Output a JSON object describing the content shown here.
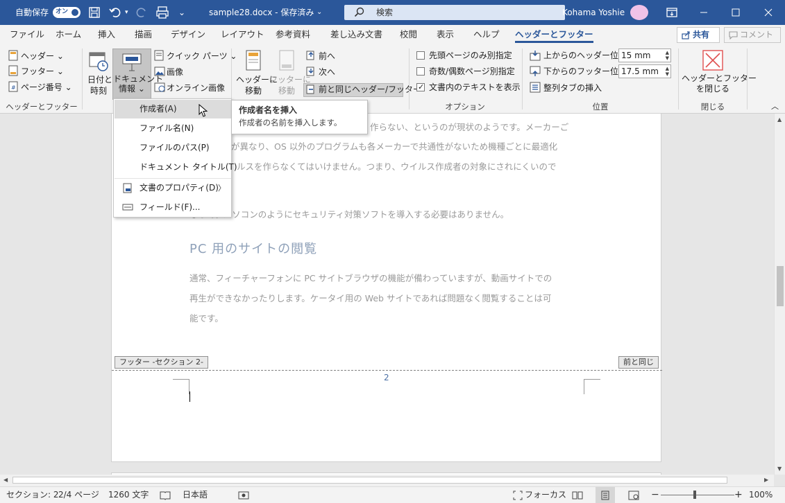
{
  "colors": {
    "title_bar": "#2b579a",
    "accent": "#2b579a",
    "ribbon_bg": "#f3f3f3",
    "close_red": "#e05050"
  },
  "titlebar": {
    "autosave_label": "自動保存",
    "autosave_state": "オン",
    "document_title": "sample28.docx - 保存済み",
    "title_chevron": "⌄",
    "search_placeholder": "検索",
    "user_name": "Kohama Yoshie",
    "qat_more": "⌄"
  },
  "tabs": {
    "items": [
      "ファイル",
      "ホーム",
      "挿入",
      "描画",
      "デザイン",
      "レイアウト",
      "参考資料",
      "差し込み文書",
      "校閲",
      "表示",
      "ヘルプ",
      "ヘッダーとフッター"
    ],
    "active": "ヘッダーとフッター",
    "share": "共有",
    "comment": "コメント"
  },
  "ribbon": {
    "hf_group": {
      "header": "ヘッダー",
      "footer": "フッター",
      "page_number": "ページ番号",
      "label": "ヘッダーとフッター"
    },
    "insert_group": {
      "date_time_line1": "日付と",
      "date_time_line2": "時刻",
      "docinfo_line1": "ドキュメント",
      "docinfo_line2": "情報",
      "quick_parts": "クイック パーツ",
      "image": "画像",
      "online_image": "オンライン画像"
    },
    "nav_group": {
      "goto_header_line1": "ヘッダーに",
      "goto_header_line2": "移動",
      "goto_footer_line1": "フッターに",
      "goto_footer_line2": "移動",
      "prev": "前へ",
      "next": "次へ",
      "link_previous": "前と同じヘッダー/フッター"
    },
    "options_group": {
      "first_page": "先頭ページのみ別指定",
      "odd_even": "奇数/偶数ページ別指定",
      "show_text": "文書内のテキストを表示",
      "show_text_checked": true,
      "label": "オプション"
    },
    "position_group": {
      "header_pos_label": "上からのヘッダー位置:",
      "header_pos_value": "15 mm",
      "footer_pos_label": "下からのフッター位置:",
      "footer_pos_value": "17.5 mm",
      "align_tab": "整列タブの挿入",
      "label": "位置"
    },
    "close_group": {
      "close_line1": "ヘッダーとフッター",
      "close_line2": "を閉じる",
      "label": "閉じる"
    }
  },
  "dropdown": {
    "items": [
      {
        "label": "作成者(A)"
      },
      {
        "label": "ファイル名(N)"
      },
      {
        "label": "ファイルのパス(P)"
      },
      {
        "label": "ドキュメント タイトル(T)"
      },
      {
        "label": "文書のプロパティ(D)"
      },
      {
        "label": "フィールド(F)..."
      }
    ]
  },
  "tooltip": {
    "title": "作成者名を挿入",
    "description": "作成者の名前を挿入します。"
  },
  "document": {
    "line1": "作らない、というのが現状のようです。メーカーご",
    "line2": "が異なり、OS 以外のプログラムも各メーカーで共通性がないため機種ごとに最適化",
    "line3": "ルスを作らなくてはいけません。つまり、ウイルス作成者の対象にされにくいので",
    "line4": "なって、パソコンのようにセキュリティ対策ソフトを導入する必要はありません。",
    "heading": "PC 用のサイトの閲覧",
    "para2_line1": "通常、フィーチャーフォンに PC サイトブラウザの機能が備わっていますが、動画サイトでの",
    "para2_line2": "再生ができなかったりします。ケータイ用の Web サイトであれば問題なく閲覧することは可",
    "para2_line3": "能です。",
    "footer_label": "フッター -セクション 2-",
    "same_as_previous": "前と同じ",
    "page_number": "2"
  },
  "statusbar": {
    "section": "セクション: 2",
    "page": "2/4 ページ",
    "words": "1260 文字",
    "language": "日本語",
    "focus": "フォーカス",
    "zoom_minus": "−",
    "zoom_plus": "+",
    "zoom": "100%"
  }
}
